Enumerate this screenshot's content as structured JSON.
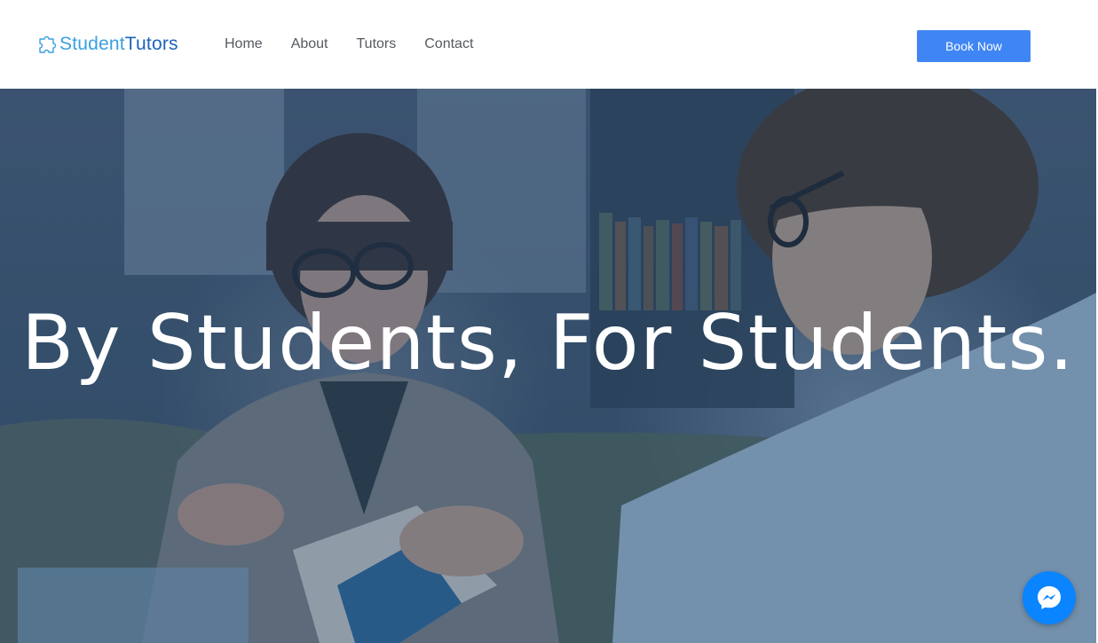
{
  "brand": {
    "name_part1": "Student",
    "name_part2": "Tutors",
    "icon": "puzzle-piece-icon",
    "colors": {
      "primary": "#3a9fe0",
      "secondary": "#1e63b8"
    }
  },
  "nav": {
    "items": [
      {
        "label": "Home"
      },
      {
        "label": "About"
      },
      {
        "label": "Tutors"
      },
      {
        "label": "Contact"
      }
    ]
  },
  "header": {
    "cta_label": "Book Now",
    "cta_color": "#3f86f4"
  },
  "hero": {
    "title": "By Students, For Students.",
    "overlay_color": "#244368"
  },
  "chat": {
    "icon": "messenger-icon",
    "color": "#0b84ff"
  }
}
